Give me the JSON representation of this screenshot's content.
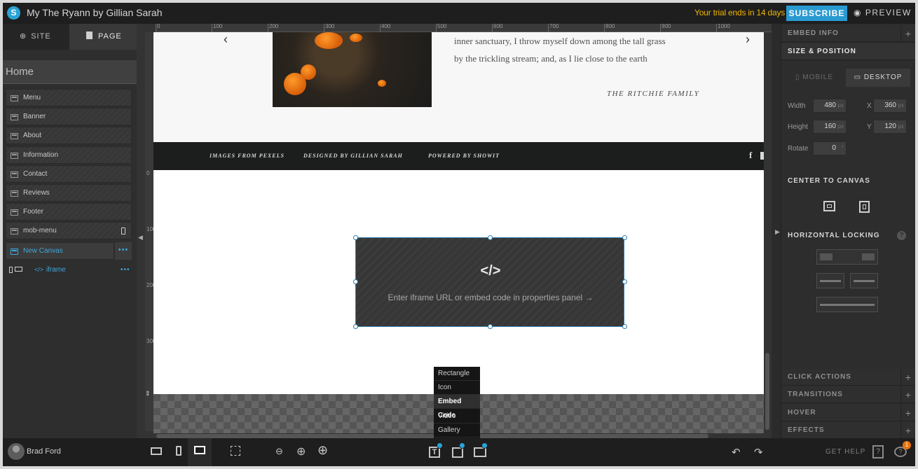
{
  "header": {
    "logo_glyph": "S",
    "site_title": "My The Ryann by Gillian Sarah",
    "trial_text": "Your trial ends in 14 days",
    "subscribe_label": "SUBSCRIBE",
    "preview_label": "PREVIEW"
  },
  "left_sidebar": {
    "tabs": [
      {
        "label": "SITE"
      },
      {
        "label": "PAGE"
      }
    ],
    "page_name": "Home",
    "items": [
      {
        "label": "Menu"
      },
      {
        "label": "Banner"
      },
      {
        "label": "About"
      },
      {
        "label": "Information"
      },
      {
        "label": "Contact"
      },
      {
        "label": "Reviews"
      },
      {
        "label": "Footer"
      },
      {
        "label": "mob-menu"
      },
      {
        "label": "New Canvas"
      }
    ],
    "active_ellipsis": "•••",
    "iframe_label": "iframe",
    "iframe_ellipsis": "•••",
    "accent_color": "#3fa7dc"
  },
  "ruler": {
    "top": [
      "0",
      "100",
      "200",
      "300",
      "400",
      "500",
      "600",
      "700",
      "800",
      "900",
      "1000"
    ],
    "left": [
      "0",
      "100",
      "200",
      "300"
    ]
  },
  "canvas": {
    "quote_lines": [
      "inner sanctuary, I throw myself down among the tall grass",
      "by the trickling stream; and, as I lie close to the earth"
    ],
    "signature": "THE RITCHIE FAMILY",
    "footer_links": [
      "IMAGES FROM PEXELS",
      "DESIGNED BY GILLIAN SARAH",
      "POWERED BY SHOWIT"
    ],
    "social_icon": "f",
    "embed_icon": "</>",
    "embed_hint": "Enter iframe URL or embed code in properties panel →"
  },
  "add_menu": {
    "items": [
      "Rectangle",
      "Icon",
      "Embed Code",
      "Video",
      "Gallery"
    ],
    "selected": "Embed Code"
  },
  "right_panel": {
    "embed_info": "EMBED INFO",
    "size_position": "SIZE & POSITION",
    "device_tabs": [
      {
        "label": "MOBILE"
      },
      {
        "label": "DESKTOP"
      }
    ],
    "active_device": "DESKTOP",
    "fields": {
      "width_label": "Width",
      "width": "480",
      "height_label": "Height",
      "height": "160",
      "rotate_label": "Rotate",
      "rotate": "0",
      "x_label": "X",
      "x": "360",
      "y_label": "Y",
      "y": "120",
      "unit_px": "px",
      "unit_deg": "°"
    },
    "center_to_canvas": "CENTER TO CANVAS",
    "horizontal_locking": "HORIZONTAL LOCKING",
    "sections": [
      "CLICK ACTIONS",
      "TRANSITIONS",
      "HOVER",
      "EFFECTS"
    ]
  },
  "bottom_bar": {
    "user_name": "Brad Ford",
    "get_help": "GET HELP",
    "notification_count": "1"
  }
}
